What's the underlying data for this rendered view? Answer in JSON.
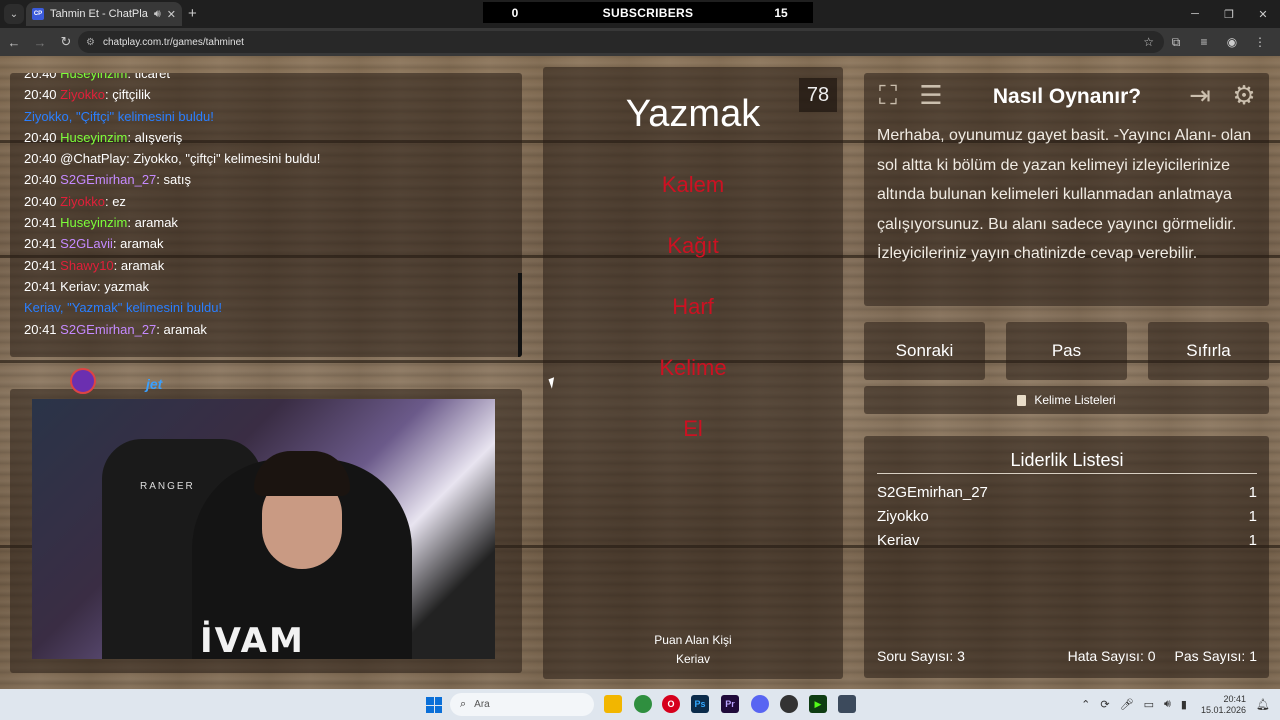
{
  "browser": {
    "tab_title": "Tahmin Et - ChatPlay",
    "tab_favicon": "CP",
    "url": "chatplay.com.tr/games/tahminet"
  },
  "subscribers": {
    "left": "0",
    "label": "SUBSCRIBERS",
    "right": "15"
  },
  "chat": [
    {
      "time": "20:40",
      "user": "Huseyinzim",
      "user_color": "#7dff3a",
      "msg": ": ticaret"
    },
    {
      "time": "20:40",
      "user": "Ziyokko",
      "user_color": "#e0203a",
      "msg": ": çiftçilik"
    },
    {
      "time": "",
      "user": "Ziyokko, \"Çiftçi\" kelimesini buldu!",
      "user_color": "#2a7fff",
      "msg": ""
    },
    {
      "time": "20:40",
      "user": "Huseyinzim",
      "user_color": "#7dff3a",
      "msg": ": alışveriş"
    },
    {
      "time": "20:40",
      "user": "@ChatPlay",
      "user_color": "#ffffff",
      "msg": ": Ziyokko, \"çiftçi\" kelimesini buldu!"
    },
    {
      "time": "20:40",
      "user": "S2GEmirhan_27",
      "user_color": "#c58aff",
      "msg": ": satış"
    },
    {
      "time": "20:40",
      "user": "Ziyokko",
      "user_color": "#e0203a",
      "msg": ": ez"
    },
    {
      "time": "20:41",
      "user": "Huseyinzim",
      "user_color": "#7dff3a",
      "msg": ": aramak"
    },
    {
      "time": "20:41",
      "user": "S2GLavii",
      "user_color": "#c58aff",
      "msg": ": aramak"
    },
    {
      "time": "20:41",
      "user": "Shawy10",
      "user_color": "#e0203a",
      "msg": ": aramak"
    },
    {
      "time": "20:41",
      "user": "Keriav",
      "user_color": "#ffffff",
      "msg": ": yazmak"
    },
    {
      "time": "",
      "user": "Keriav, \"Yazmak\" kelimesini buldu!",
      "user_color": "#2a7fff",
      "msg": ""
    },
    {
      "time": "20:41",
      "user": "S2GEmirhan_27",
      "user_color": "#c58aff",
      "msg": ": aramak"
    }
  ],
  "webcam": {
    "brand": "jet",
    "shirt_text": "İVAM",
    "chair_text": "RANGER"
  },
  "game": {
    "timer": "78",
    "word": "Yazmak",
    "forbidden": [
      "Kalem",
      "Kağıt",
      "Harf",
      "Kelime",
      "El"
    ],
    "forbidden_color": "#cc1122",
    "scorer_label": "Puan Alan Kişi",
    "scorer_name": "Keriav"
  },
  "howto": {
    "title": "Nasıl Oynanır?",
    "text": "Merhaba, oyunumuz gayet basit. -Yayıncı Alanı- olan sol altta ki bölüm de yazan kelimeyi izleyicilerinize altında bulunan kelimeleri kullanmadan anlatmaya çalışıyorsunuz. Bu alanı sadece yayıncı görmelidir. İzleyicileriniz yayın chatinizde cevap verebilir."
  },
  "buttons": {
    "next": "Sonraki",
    "pass": "Pas",
    "reset": "Sıfırla",
    "word_lists": "Kelime Listeleri"
  },
  "leaderboard": {
    "title": "Liderlik Listesi",
    "rows": [
      {
        "name": "S2GEmirhan_27",
        "score": "1"
      },
      {
        "name": "Ziyokko",
        "score": "1"
      },
      {
        "name": "Keriav",
        "score": "1"
      }
    ],
    "stats": {
      "questions": "Soru Sayısı: 3",
      "errors": "Hata Sayısı: 0",
      "passes": "Pas Sayısı: 1"
    }
  },
  "taskbar": {
    "search_placeholder": "Ara",
    "time": "20:41",
    "date": "15.01.2026"
  },
  "icons": [
    "fullscreen-icon",
    "notes-icon",
    "exit-icon",
    "gear-icon",
    "search-icon",
    "windows-icon"
  ]
}
